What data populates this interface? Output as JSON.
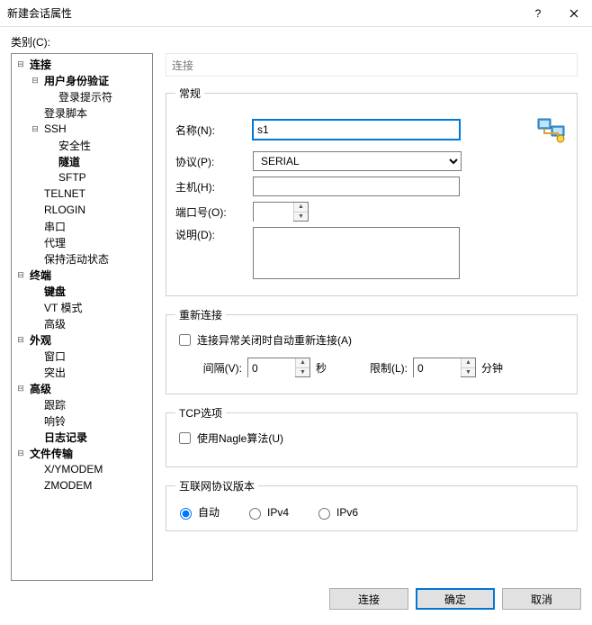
{
  "title": "新建会话属性",
  "category_label": "类别(C):",
  "tree": {
    "connection": "连接",
    "user_auth": "用户身份验证",
    "login_prompt": "登录提示符",
    "login_script": "登录脚本",
    "ssh": "SSH",
    "security": "安全性",
    "tunnel": "隧道",
    "sftp": "SFTP",
    "telnet": "TELNET",
    "rlogin": "RLOGIN",
    "serial": "串口",
    "proxy": "代理",
    "keepalive": "保持活动状态",
    "terminal": "终端",
    "keyboard": "键盘",
    "vt_mode": "VT 模式",
    "advanced_term": "高级",
    "appearance": "外观",
    "window": "窗口",
    "highlight": "突出",
    "advanced": "高级",
    "trace": "跟踪",
    "bell": "响铃",
    "logging": "日志记录",
    "file_transfer": "文件传输",
    "xymodem": "X/YMODEM",
    "zmodem": "ZMODEM"
  },
  "panel_header": "连接",
  "general": {
    "legend": "常规",
    "name_label": "名称(N):",
    "name_value": "s1",
    "protocol_label": "协议(P):",
    "protocol_value": "SERIAL",
    "host_label": "主机(H):",
    "host_value": "",
    "port_label": "端口号(O):",
    "port_value": "",
    "desc_label": "说明(D):",
    "desc_value": ""
  },
  "reconnect": {
    "legend": "重新连接",
    "checkbox_label": "连接异常关闭时自动重新连接(A)",
    "interval_label": "间隔(V):",
    "interval_value": "0",
    "interval_unit": "秒",
    "limit_label": "限制(L):",
    "limit_value": "0",
    "limit_unit": "分钟"
  },
  "tcp": {
    "legend": "TCP选项",
    "nagle_label": "使用Nagle算法(U)"
  },
  "ipver": {
    "legend": "互联网协议版本",
    "auto": "自动",
    "ipv4": "IPv4",
    "ipv6": "IPv6"
  },
  "buttons": {
    "connect": "连接",
    "ok": "确定",
    "cancel": "取消"
  }
}
